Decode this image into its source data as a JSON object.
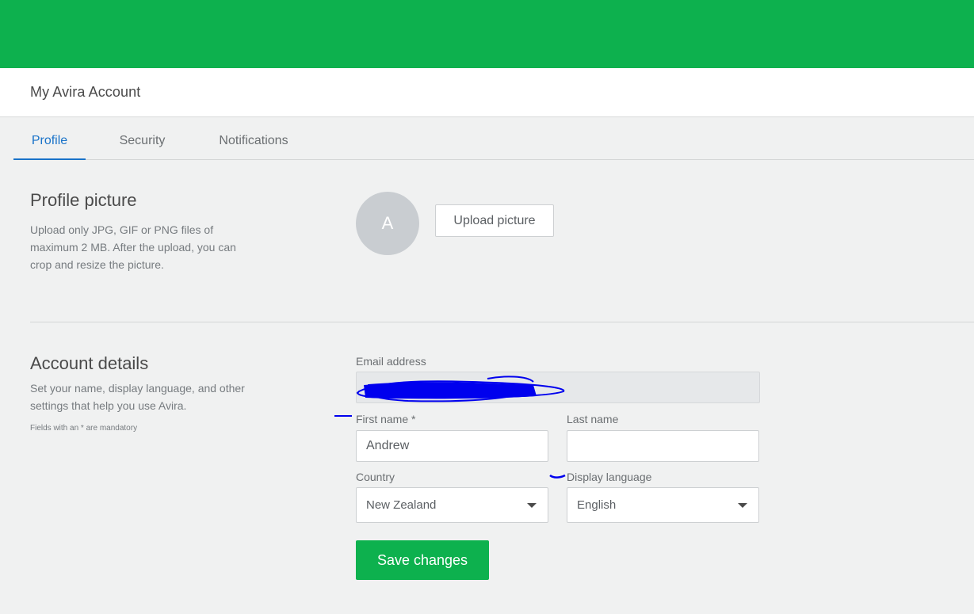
{
  "header": {
    "app_title": "My Avira Account"
  },
  "tabs": [
    {
      "label": "Profile",
      "active": true
    },
    {
      "label": "Security",
      "active": false
    },
    {
      "label": "Notifications",
      "active": false
    }
  ],
  "profile_picture": {
    "title": "Profile picture",
    "description": "Upload only JPG, GIF or PNG files of maximum 2 MB. After the upload, you can crop and resize the picture.",
    "avatar_initial": "A",
    "upload_label": "Upload picture"
  },
  "account_details": {
    "title": "Account details",
    "description": "Set your name, display language, and other settings that help you use Avira.",
    "mandatory_note": "Fields with an * are mandatory",
    "email_label": "Email address",
    "first_name_label": "First name *",
    "first_name_value": "Andrew",
    "last_name_label": "Last name",
    "last_name_value": "",
    "country_label": "Country",
    "country_value": "New Zealand",
    "language_label": "Display language",
    "language_value": "English",
    "save_label": "Save changes"
  },
  "colors": {
    "brand_green": "#0db14e",
    "tab_active_blue": "#1a73c9",
    "redaction_blue": "#0000ee"
  }
}
